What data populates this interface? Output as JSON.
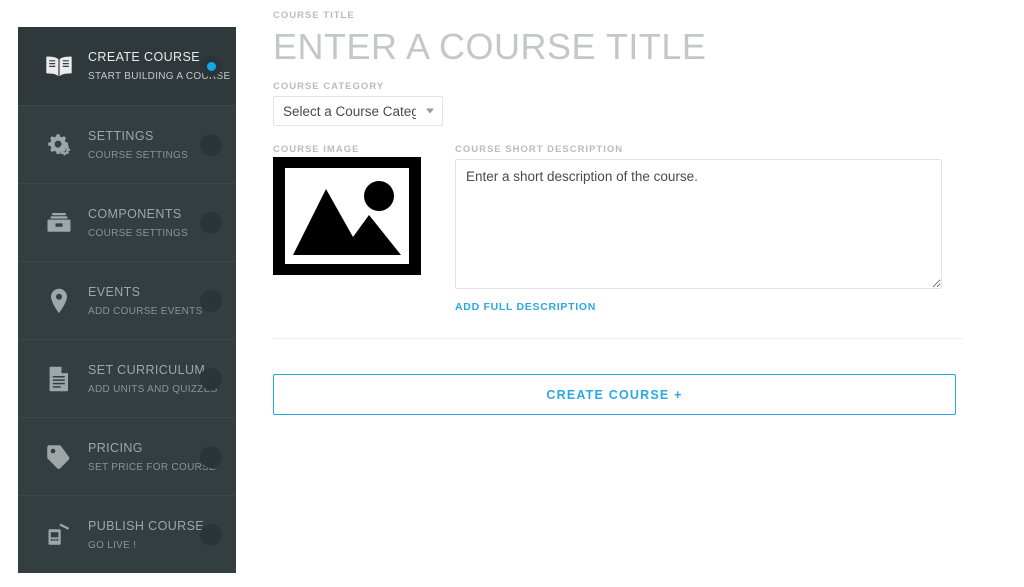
{
  "sidebar": {
    "items": [
      {
        "icon": "book-open-icon",
        "title": "CREATE COURSE",
        "sub": "START BUILDING A COURSE",
        "active": true
      },
      {
        "icon": "gears-icon",
        "title": "SETTINGS",
        "sub": "COURSE SETTINGS",
        "active": false
      },
      {
        "icon": "toolbox-icon",
        "title": "COMPONENTS",
        "sub": "COURSE SETTINGS",
        "active": false
      },
      {
        "icon": "map-pin-icon",
        "title": "EVENTS",
        "sub": "ADD COURSE EVENTS",
        "active": false
      },
      {
        "icon": "document-icon",
        "title": "SET CURRICULUM",
        "sub": "ADD UNITS AND QUIZZES",
        "active": false
      },
      {
        "icon": "price-tag-icon",
        "title": "PRICING",
        "sub": "SET PRICE FOR COURSE",
        "active": false
      },
      {
        "icon": "megaphone-icon",
        "title": "PUBLISH COURSE",
        "sub": "GO LIVE !",
        "active": false
      }
    ]
  },
  "main": {
    "title_label": "COURSE TITLE",
    "title_placeholder": "ENTER A COURSE TITLE",
    "title_value": "",
    "category_label": "COURSE CATEGORY",
    "category_selected": "Select a Course Category",
    "category_options": [
      "Select a Course Category"
    ],
    "image_label": "COURSE IMAGE",
    "image_icon": "photo-placeholder-icon",
    "description_label": "COURSE SHORT DESCRIPTION",
    "description_placeholder": "Enter a short description of the course.",
    "description_value": "",
    "full_description_link": "ADD FULL DESCRIPTION",
    "create_button": "CREATE COURSE +"
  },
  "colors": {
    "sidebar_bg": "#333e40",
    "sidebar_active_bg": "#2f393b",
    "accent_blue": "#13a6e8",
    "link_blue": "#2da8e0",
    "button_border": "#23a6e2"
  }
}
